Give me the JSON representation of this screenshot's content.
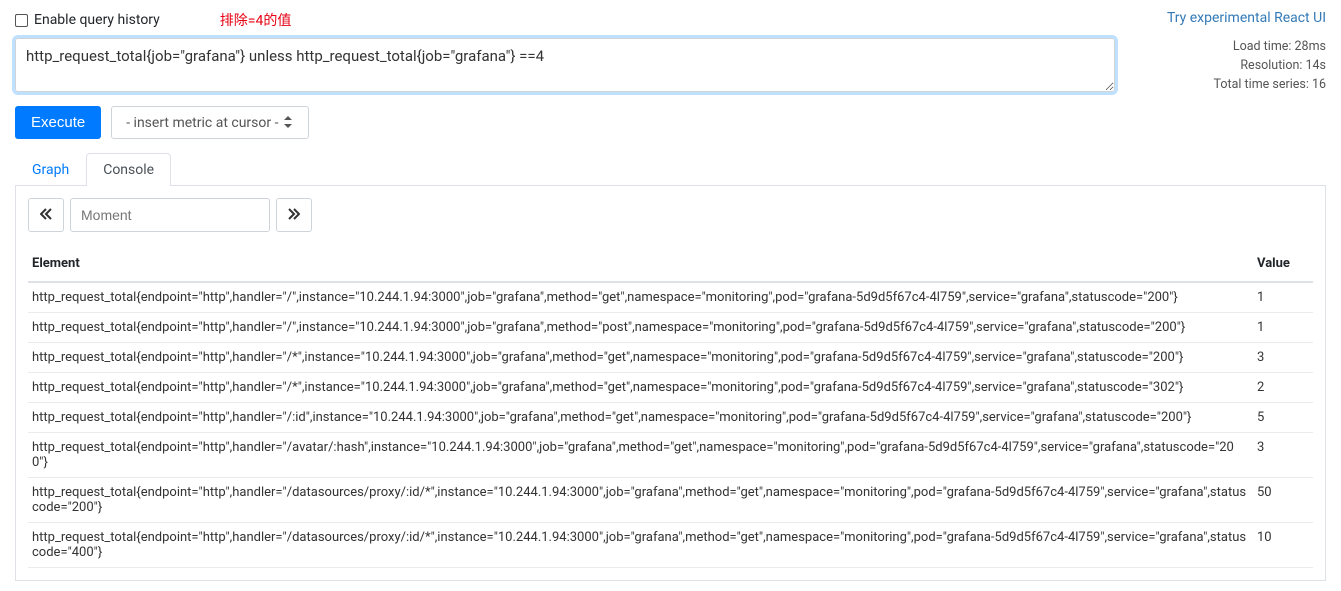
{
  "top": {
    "enable_history_label": "Enable query history",
    "annotation": "排除=4的值",
    "react_link": "Try experimental React UI"
  },
  "query": {
    "expression": "http_request_total{job=\"grafana\"} unless http_request_total{job=\"grafana\"} ==4"
  },
  "stats": {
    "load_time": "Load time: 28ms",
    "resolution": "Resolution: 14s",
    "total_series": "Total time series: 16"
  },
  "controls": {
    "execute_label": "Execute",
    "metric_placeholder": "- insert metric at cursor -"
  },
  "tabs": {
    "graph": "Graph",
    "console": "Console"
  },
  "moment": {
    "placeholder": "Moment"
  },
  "table": {
    "header_element": "Element",
    "header_value": "Value",
    "rows": [
      {
        "el": "http_request_total{endpoint=\"http\",handler=\"/\",instance=\"10.244.1.94:3000\",job=\"grafana\",method=\"get\",namespace=\"monitoring\",pod=\"grafana-5d9d5f67c4-4l759\",service=\"grafana\",statuscode=\"200\"}",
        "val": "1"
      },
      {
        "el": "http_request_total{endpoint=\"http\",handler=\"/\",instance=\"10.244.1.94:3000\",job=\"grafana\",method=\"post\",namespace=\"monitoring\",pod=\"grafana-5d9d5f67c4-4l759\",service=\"grafana\",statuscode=\"200\"}",
        "val": "1"
      },
      {
        "el": "http_request_total{endpoint=\"http\",handler=\"/*\",instance=\"10.244.1.94:3000\",job=\"grafana\",method=\"get\",namespace=\"monitoring\",pod=\"grafana-5d9d5f67c4-4l759\",service=\"grafana\",statuscode=\"200\"}",
        "val": "3"
      },
      {
        "el": "http_request_total{endpoint=\"http\",handler=\"/*\",instance=\"10.244.1.94:3000\",job=\"grafana\",method=\"get\",namespace=\"monitoring\",pod=\"grafana-5d9d5f67c4-4l759\",service=\"grafana\",statuscode=\"302\"}",
        "val": "2"
      },
      {
        "el": "http_request_total{endpoint=\"http\",handler=\"/:id\",instance=\"10.244.1.94:3000\",job=\"grafana\",method=\"get\",namespace=\"monitoring\",pod=\"grafana-5d9d5f67c4-4l759\",service=\"grafana\",statuscode=\"200\"}",
        "val": "5"
      },
      {
        "el": "http_request_total{endpoint=\"http\",handler=\"/avatar/:hash\",instance=\"10.244.1.94:3000\",job=\"grafana\",method=\"get\",namespace=\"monitoring\",pod=\"grafana-5d9d5f67c4-4l759\",service=\"grafana\",statuscode=\"200\"}",
        "val": "3"
      },
      {
        "el": "http_request_total{endpoint=\"http\",handler=\"/datasources/proxy/:id/*\",instance=\"10.244.1.94:3000\",job=\"grafana\",method=\"get\",namespace=\"monitoring\",pod=\"grafana-5d9d5f67c4-4l759\",service=\"grafana\",statuscode=\"200\"}",
        "val": "50"
      },
      {
        "el": "http_request_total{endpoint=\"http\",handler=\"/datasources/proxy/:id/*\",instance=\"10.244.1.94:3000\",job=\"grafana\",method=\"get\",namespace=\"monitoring\",pod=\"grafana-5d9d5f67c4-4l759\",service=\"grafana\",statuscode=\"400\"}",
        "val": "10"
      }
    ]
  }
}
